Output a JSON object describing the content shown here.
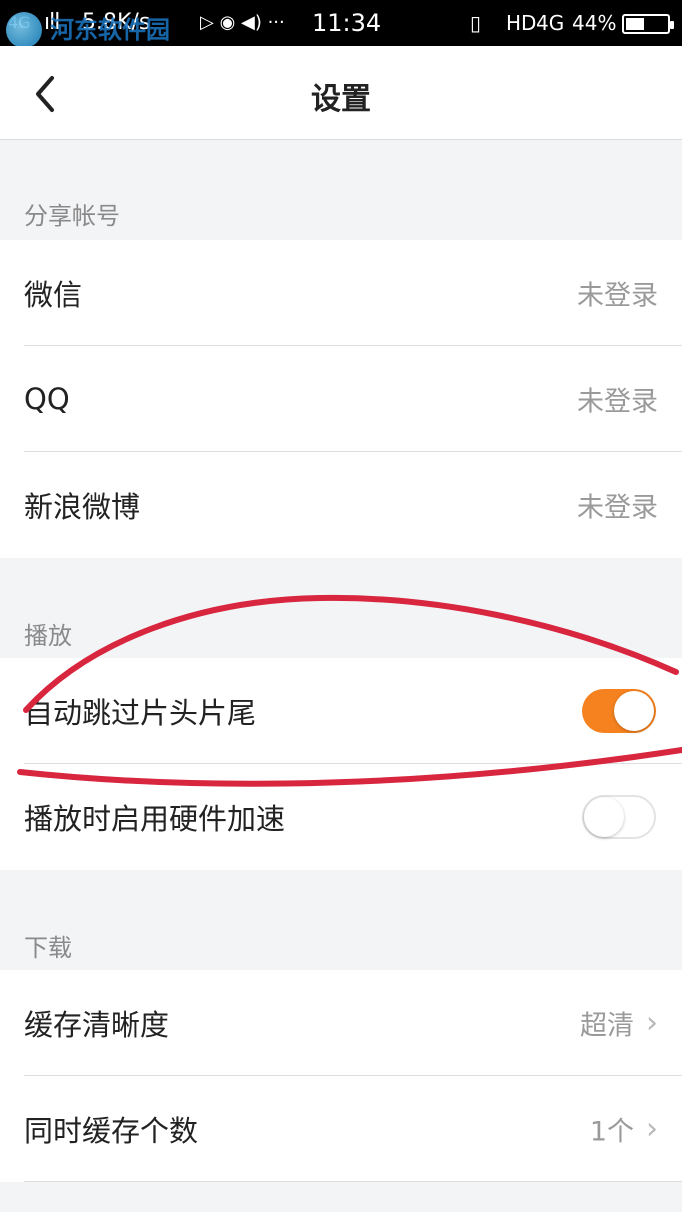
{
  "status_bar": {
    "signal": "4G",
    "bars": "ıll",
    "speed": "5.8K/s",
    "icons": "▷ ◉ ◀) ···",
    "time": "11:34",
    "vibrate": "▯",
    "hd": "HD",
    "network": "4G",
    "battery": "44%",
    "battery_level": 0.44
  },
  "watermark": {
    "title": "河东软件园",
    "url": "www.pc0359.cn"
  },
  "header": {
    "back_label": "‹",
    "title": "设置"
  },
  "sections": [
    {
      "title": "分享帐号",
      "rows": [
        {
          "label": "微信",
          "value": "未登录"
        },
        {
          "label": "QQ",
          "value": "未登录"
        },
        {
          "label": "新浪微博",
          "value": "未登录"
        }
      ]
    },
    {
      "title": "播放",
      "rows": [
        {
          "label": "自动跳过片头片尾",
          "toggle": true
        },
        {
          "label": "播放时启用硬件加速",
          "toggle": false
        }
      ]
    },
    {
      "title": "下载",
      "rows": [
        {
          "label": "缓存清晰度",
          "value": "超清"
        },
        {
          "label": "同时缓存个数",
          "value": "1个"
        }
      ]
    }
  ],
  "colors": {
    "accent": "#f5821f",
    "annotation": "#d8263f"
  }
}
